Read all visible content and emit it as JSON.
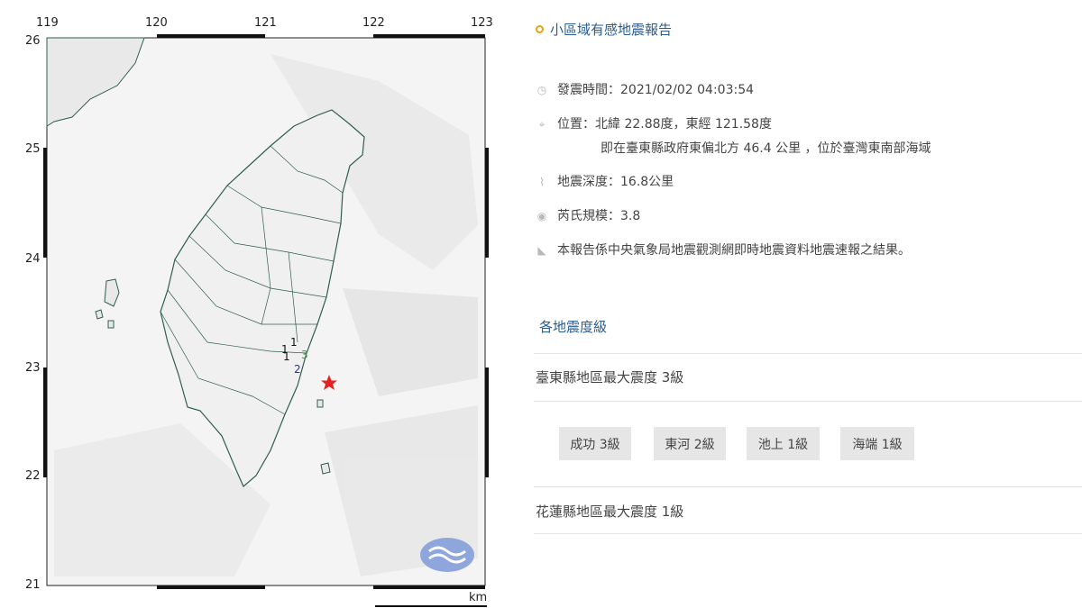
{
  "map": {
    "lon_ticks": [
      "119",
      "120",
      "121",
      "122",
      "123"
    ],
    "lat_ticks": [
      "26",
      "25",
      "24",
      "23",
      "22",
      "21"
    ],
    "unit_label": "km",
    "station_markers": [
      "1",
      "1",
      "1",
      "3",
      "2"
    ],
    "epicenter_color": "#e62020",
    "land_color": "#e8e8e8",
    "sea_color": "#f5f5f5"
  },
  "report": {
    "title": "小區域有感地震報告",
    "time": "發震時間：2021/02/02 04:03:54",
    "location": "位置：北緯 22.88度，東經 121.58度",
    "location_detail": "即在臺東縣政府東偏北方 46.4 公里 ，位於臺灣東南部海域",
    "depth": "地震深度：16.8公里",
    "magnitude": "芮氏規模：3.8",
    "note": "本報告係中央氣象局地震觀測網即時地震資料地震速報之結果。",
    "section_title": "各地震度級",
    "county1": "臺東縣地區最大震度 3級",
    "stations": [
      "成功 3級",
      "東河 2級",
      "池上 1級",
      "海端 1級"
    ],
    "county2": "花蓮縣地區最大震度 1級"
  }
}
